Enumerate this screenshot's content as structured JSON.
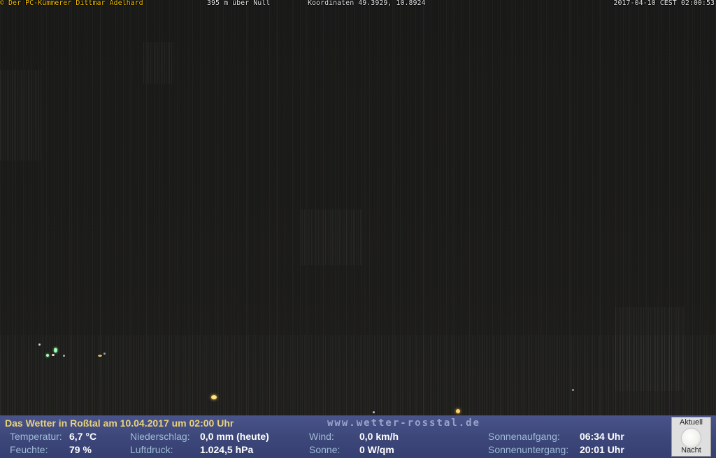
{
  "overlay": {
    "credit": "© Der PC-Kümmerer Dittmar Adelhard",
    "altitude": "395 m über Null",
    "coordinates": "Koordinaten 49.3929, 10.8924",
    "timestamp": "2017-04-10 CEST 02:00:53"
  },
  "weather": {
    "title": "Das Wetter in Roßtal am 10.04.2017 um 02:00 Uhr",
    "site": "www.wetter-rosstal.de",
    "temperature": {
      "label": "Temperatur:",
      "value": "6,7 °C"
    },
    "humidity": {
      "label": "Feuchte:",
      "value": "79 %"
    },
    "precipitation": {
      "label": "Niederschlag:",
      "value": "0,0 mm (heute)"
    },
    "pressure": {
      "label": "Luftdruck:",
      "value": "1.024,5 hPa"
    },
    "wind": {
      "label": "Wind:",
      "value": "0,0 km/h"
    },
    "sun": {
      "label": "Sonne:",
      "value": "0 W/qm"
    },
    "sunrise": {
      "label": "Sonnenaufgang:",
      "value": "06:34 Uhr"
    },
    "sunset": {
      "label": "Sonnenuntergang:",
      "value": "20:01 Uhr"
    },
    "moon": {
      "top_label": "Aktuell",
      "bottom_label": "Nacht",
      "icon": "moon-icon"
    }
  },
  "colors": {
    "credit": "#f2c200",
    "panel": "#414b80",
    "title": "#e8d27a",
    "label": "#9fbcd6",
    "value": "#ffffff"
  }
}
